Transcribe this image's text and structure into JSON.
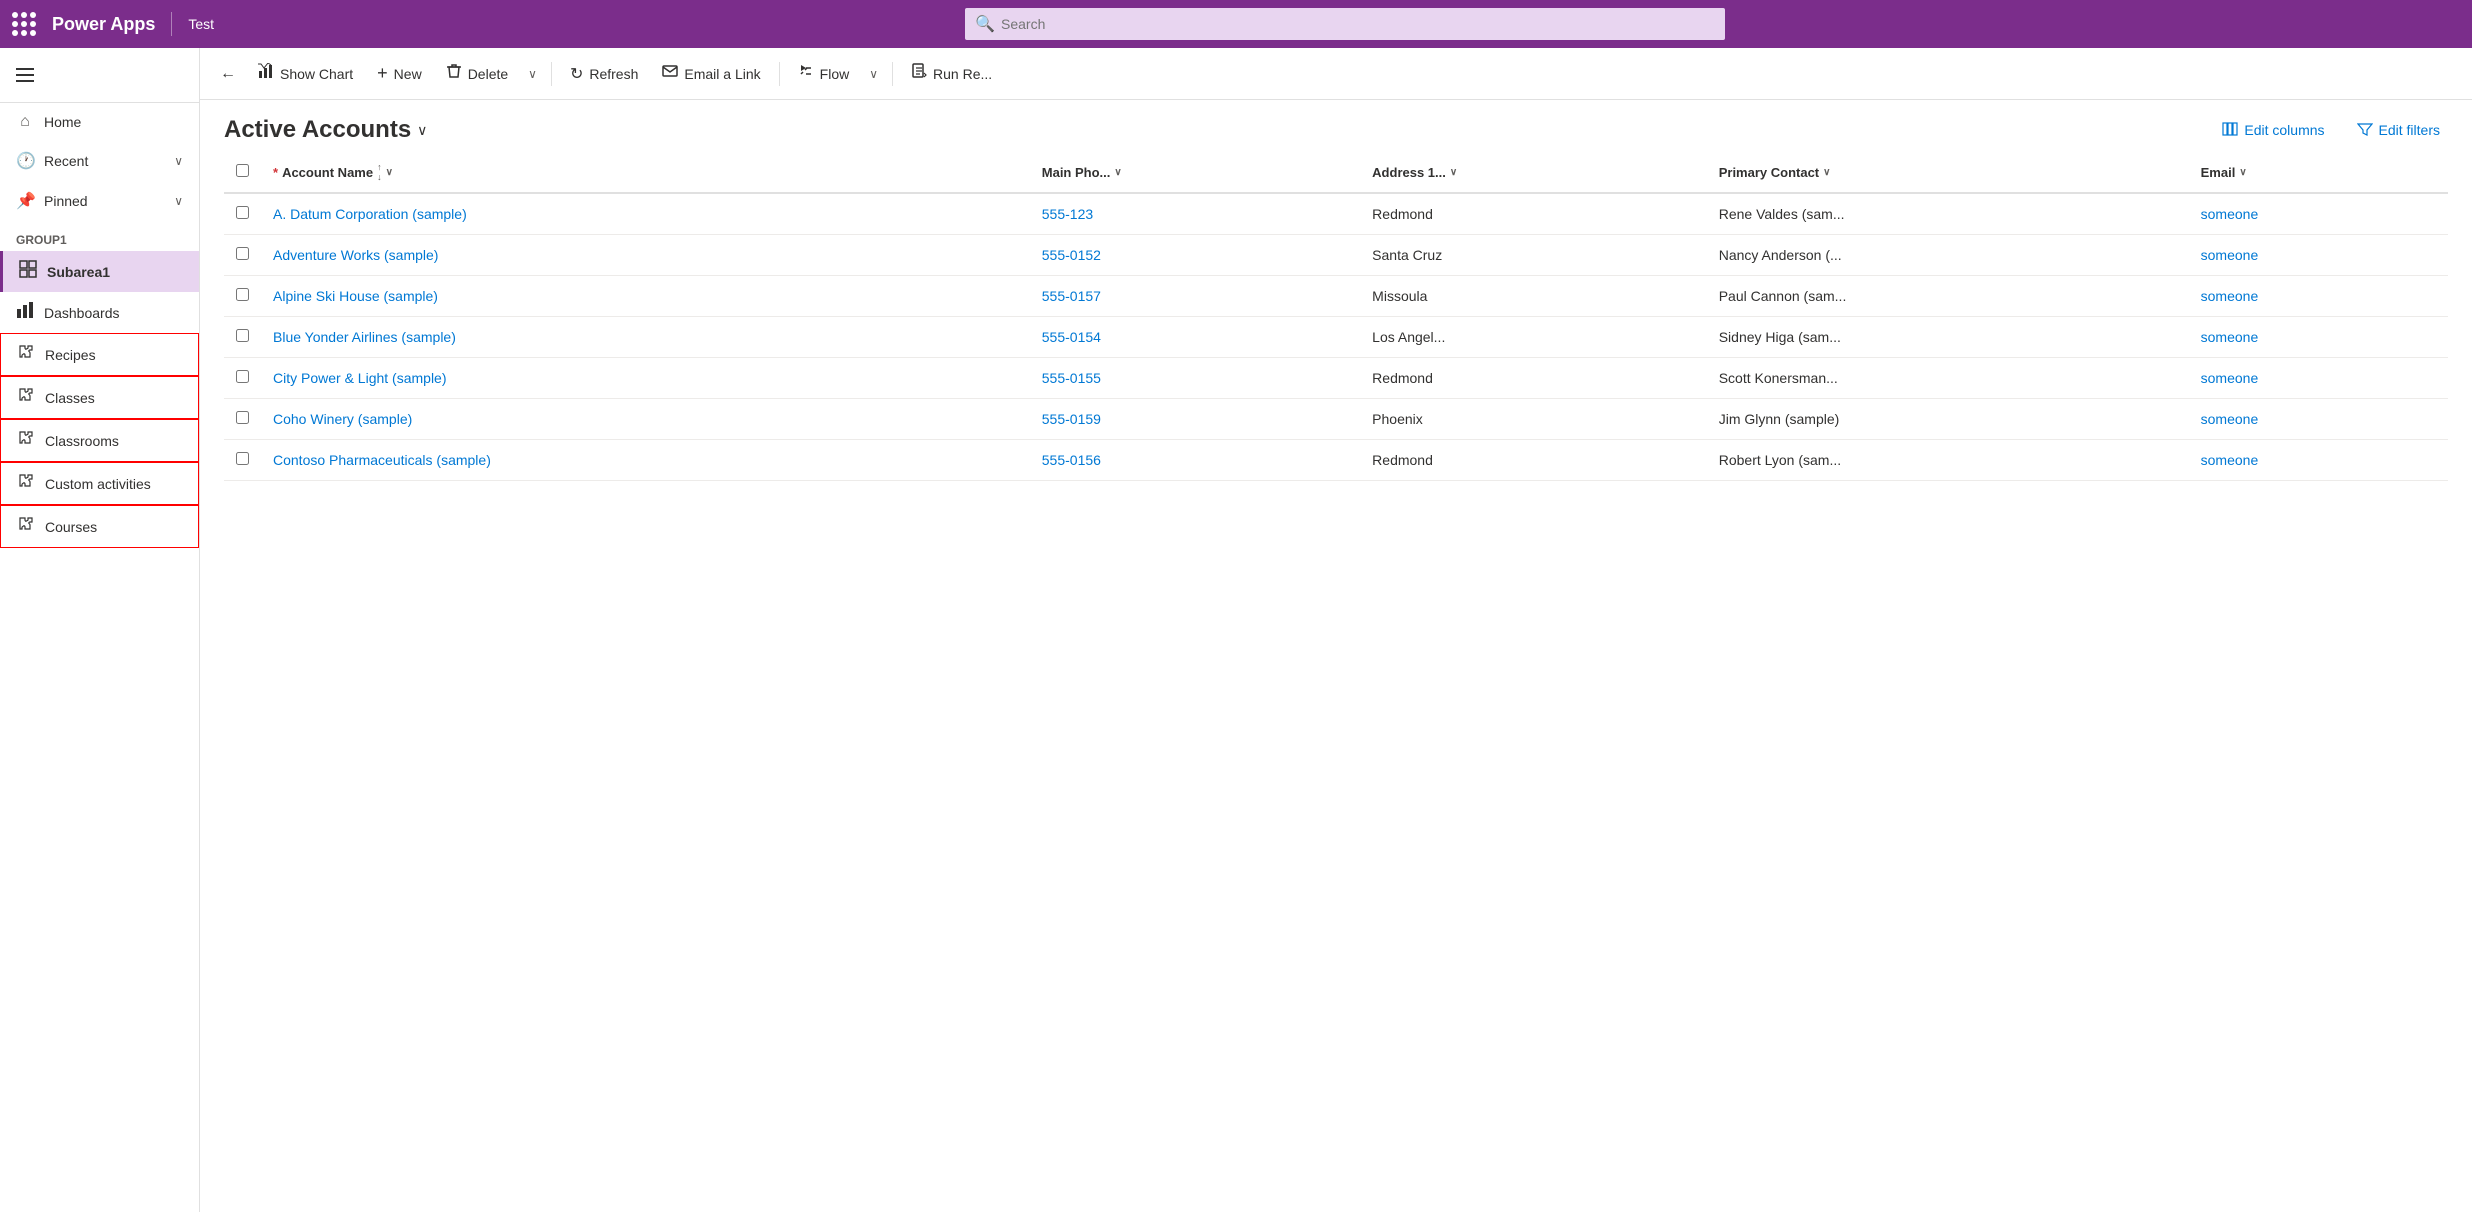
{
  "topNav": {
    "brand": "Power Apps",
    "divider": "|",
    "appName": "Test",
    "searchPlaceholder": "Search"
  },
  "sidebar": {
    "hamburgerLabel": "Menu",
    "navItems": [
      {
        "id": "home",
        "label": "Home",
        "icon": "home"
      },
      {
        "id": "recent",
        "label": "Recent",
        "icon": "clock",
        "hasChevron": true
      },
      {
        "id": "pinned",
        "label": "Pinned",
        "icon": "pin",
        "hasChevron": true
      }
    ],
    "groupLabel": "Group1",
    "groupItems": [
      {
        "id": "subarea1",
        "label": "Subarea1",
        "icon": "grid",
        "active": true
      },
      {
        "id": "dashboards",
        "label": "Dashboards",
        "icon": "chart"
      },
      {
        "id": "recipes",
        "label": "Recipes",
        "icon": "puzzle",
        "highlighted": true
      },
      {
        "id": "classes",
        "label": "Classes",
        "icon": "puzzle",
        "highlighted": true
      },
      {
        "id": "classrooms",
        "label": "Classrooms",
        "icon": "puzzle",
        "highlighted": true
      },
      {
        "id": "custom-activities",
        "label": "Custom activities",
        "icon": "puzzle",
        "highlighted": true
      },
      {
        "id": "courses",
        "label": "Courses",
        "icon": "puzzle",
        "highlighted": true
      }
    ]
  },
  "toolbar": {
    "backLabel": "←",
    "showChartLabel": "Show Chart",
    "newLabel": "New",
    "deleteLabel": "Delete",
    "refreshLabel": "Refresh",
    "emailLinkLabel": "Email a Link",
    "flowLabel": "Flow",
    "runReportLabel": "Run Re..."
  },
  "pageHeader": {
    "title": "Active Accounts",
    "editColumnsLabel": "Edit columns",
    "editFiltersLabel": "Edit filters"
  },
  "table": {
    "columns": [
      {
        "id": "account-name",
        "label": "Account Name",
        "required": true,
        "sortable": true,
        "hasChevron": true
      },
      {
        "id": "main-phone",
        "label": "Main Pho...",
        "hasChevron": true
      },
      {
        "id": "address",
        "label": "Address 1...",
        "hasChevron": true
      },
      {
        "id": "primary-contact",
        "label": "Primary Contact",
        "hasChevron": true
      },
      {
        "id": "email",
        "label": "Email",
        "hasChevron": true
      }
    ],
    "rows": [
      {
        "accountName": "A. Datum Corporation (sample)",
        "mainPhone": "555-123",
        "address": "Redmond",
        "primaryContact": "Rene Valdes (sam...",
        "email": "someone"
      },
      {
        "accountName": "Adventure Works (sample)",
        "mainPhone": "555-0152",
        "address": "Santa Cruz",
        "primaryContact": "Nancy Anderson (...",
        "email": "someone"
      },
      {
        "accountName": "Alpine Ski House (sample)",
        "mainPhone": "555-0157",
        "address": "Missoula",
        "primaryContact": "Paul Cannon (sam...",
        "email": "someone"
      },
      {
        "accountName": "Blue Yonder Airlines (sample)",
        "mainPhone": "555-0154",
        "address": "Los Angel...",
        "primaryContact": "Sidney Higa (sam...",
        "email": "someone"
      },
      {
        "accountName": "City Power & Light (sample)",
        "mainPhone": "555-0155",
        "address": "Redmond",
        "primaryContact": "Scott Konersman...",
        "email": "someone"
      },
      {
        "accountName": "Coho Winery (sample)",
        "mainPhone": "555-0159",
        "address": "Phoenix",
        "primaryContact": "Jim Glynn (sample)",
        "email": "someone"
      },
      {
        "accountName": "Contoso Pharmaceuticals (sample)",
        "mainPhone": "555-0156",
        "address": "Redmond",
        "primaryContact": "Robert Lyon (sam...",
        "email": "someone"
      }
    ]
  },
  "colors": {
    "brand": "#7b2d8b",
    "link": "#0078d4",
    "danger": "#d13438"
  }
}
